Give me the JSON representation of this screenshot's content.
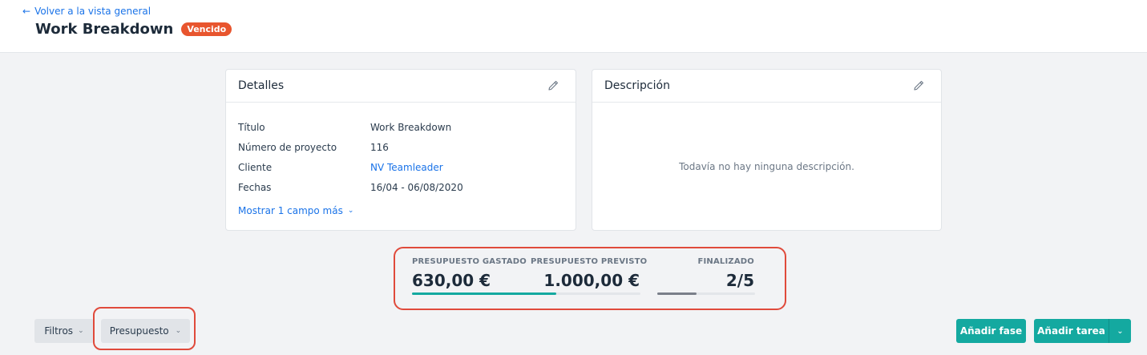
{
  "header": {
    "back_link": "Volver a la vista general",
    "title": "Work Breakdown",
    "status_badge": "Vencido"
  },
  "details": {
    "title": "Detalles",
    "fields": [
      {
        "label": "Título",
        "value": "Work Breakdown"
      },
      {
        "label": "Número de proyecto",
        "value": "116"
      },
      {
        "label": "Cliente",
        "value": "NV Teamleader"
      },
      {
        "label": "Fechas",
        "value": "16/04 - 06/08/2020"
      }
    ],
    "show_more": "Mostrar 1 campo más"
  },
  "description": {
    "title": "Descripción",
    "empty_text": "Todavía no hay ninguna descripción."
  },
  "stats": {
    "spent_label": "PRESUPUESTO GASTADO",
    "spent_value": "630,00 €",
    "planned_label": "PRESUPUESTO PREVISTO",
    "planned_value": "1.000,00 €",
    "budget_progress": 0.63,
    "finished_label": "FINALIZADO",
    "finished_value": "2/5",
    "finished_progress": 0.4
  },
  "toolbar": {
    "filters_label": "Filtros",
    "budget_label": "Presupuesto",
    "add_phase_label": "Añadir fase",
    "add_task_label": "Añadir tarea"
  },
  "colors": {
    "accent": "#14a9a0",
    "link": "#1a73e8",
    "badge": "#e8552e",
    "highlight": "#e04a3b",
    "finished_bar": "#7a7f8a"
  },
  "icons": [
    "arrow-left-icon",
    "pencil-icon",
    "chevron-down-icon"
  ]
}
